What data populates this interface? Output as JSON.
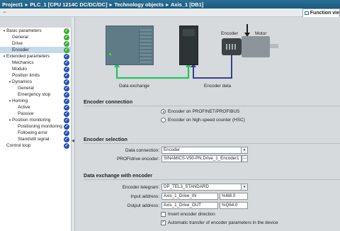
{
  "breadcrumb": {
    "items": [
      "Project1",
      "PLC_1 [CPU 1214C DC/DC/DC]",
      "Technology objects",
      "Axis_1 [DB1]"
    ],
    "separator": "▸"
  },
  "toolbar": {
    "tool_glyph": "⇔",
    "function_view_label": "Function vie"
  },
  "nav": {
    "items": [
      {
        "label": "Basic parameters",
        "level": 0,
        "expander": "▾",
        "status": "ok"
      },
      {
        "label": "General",
        "level": 1,
        "expander": "",
        "status": "ok"
      },
      {
        "label": "Drive",
        "level": 1,
        "expander": "",
        "status": "ok"
      },
      {
        "label": "Encoder",
        "level": 1,
        "expander": "",
        "status": "ok",
        "selected": true
      },
      {
        "label": "Extended parameters",
        "level": 0,
        "expander": "▾",
        "status": "info"
      },
      {
        "label": "Mechanics",
        "level": 1,
        "expander": "",
        "status": "info"
      },
      {
        "label": "Modulo",
        "level": 1,
        "expander": "",
        "status": "info"
      },
      {
        "label": "Position limits",
        "level": 1,
        "expander": "",
        "status": "info"
      },
      {
        "label": "Dynamics",
        "level": 1,
        "expander": "▾",
        "status": "info"
      },
      {
        "label": "General",
        "level": 2,
        "expander": "",
        "status": "info"
      },
      {
        "label": "Emergency stop",
        "level": 2,
        "expander": "",
        "status": "info"
      },
      {
        "label": "Homing",
        "level": 1,
        "expander": "▾",
        "status": "info"
      },
      {
        "label": "Active",
        "level": 2,
        "expander": "",
        "status": "info"
      },
      {
        "label": "Passive",
        "level": 2,
        "expander": "",
        "status": "info"
      },
      {
        "label": "Position monitoring",
        "level": 1,
        "expander": "▾",
        "status": "info"
      },
      {
        "label": "Positioning monitoring",
        "level": 2,
        "expander": "",
        "status": "info"
      },
      {
        "label": "Following error",
        "level": 2,
        "expander": "",
        "status": "info"
      },
      {
        "label": "Standstill signal",
        "level": 2,
        "expander": "",
        "status": "info"
      },
      {
        "label": "Control loop",
        "level": 0,
        "expander": "",
        "status": "info"
      }
    ]
  },
  "diagram": {
    "encoder_label": "Encoder",
    "motor_label": "Motor",
    "data_exchange_label": "Data exchange",
    "encoder_data_label": "Encoder data",
    "colors": {
      "data_exchange_line": "#22c55e",
      "encoder_data_line": "#3b3f8f",
      "arrow": "#1e1e1e"
    }
  },
  "encoder_connection": {
    "title": "Encoder connection",
    "options": [
      {
        "label": "Encoder on PROFINET/PROFIBUS",
        "checked": true
      },
      {
        "label": "Encoder on high-speed counter (HSC)",
        "checked": false
      }
    ]
  },
  "encoder_selection": {
    "title": "Encoder selection",
    "data_connection_label": "Data connection:",
    "data_connection_value": "Encoder",
    "profidrive_label": "PROFIdrive encoder:",
    "profidrive_value": "SINAMICS-V90-PN.Drive_1_Encoder1",
    "browse_label": "..."
  },
  "data_exchange": {
    "title": "Data exchange with encoder",
    "telegram_label": "Encoder telegram:",
    "telegram_value": "DP_TEL3_STANDARD",
    "input_label": "Input address:",
    "input_value": "Axis_1_Drive_IN",
    "input_addr": "%I68.0",
    "output_label": "Output address:",
    "output_value": "Axis_1_Drive_OUT",
    "output_addr": "%Q64.0",
    "invert_label": "Invert encoder direction",
    "invert_checked": false,
    "auto_label": "Automatic transfer of encoder parameters in the device",
    "auto_checked": true
  },
  "icons": {
    "dropdown": "▾",
    "status_ok": "✓",
    "status_info": "✓",
    "checkmark": "✓",
    "splitter_grip": "◀"
  }
}
